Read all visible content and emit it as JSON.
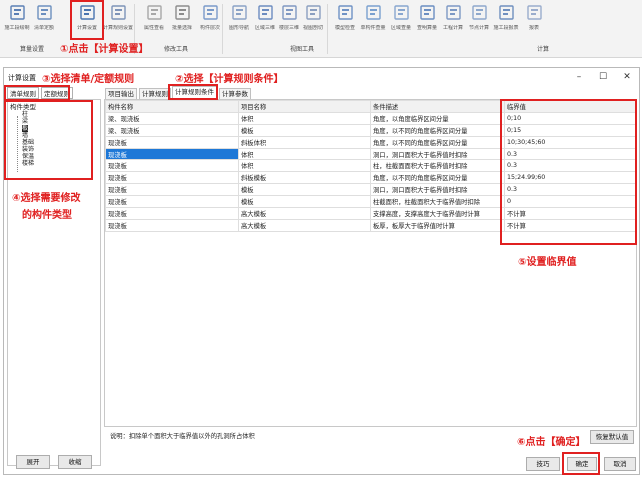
{
  "ribbon": {
    "buttons": [
      {
        "label": "施工段绘制",
        "icon": "floor-plan-icon"
      },
      {
        "label": "清单定额",
        "icon": "list-icon"
      },
      {
        "label": "计算设置",
        "icon": "calc-settings-icon"
      },
      {
        "label": "计算规则设置",
        "icon": "rules-icon"
      },
      {
        "label": "属性查看",
        "icon": "bulb-icon"
      },
      {
        "label": "批量选择",
        "icon": "filter-icon"
      },
      {
        "label": "构件层次",
        "icon": "layers-icon"
      },
      {
        "label": "图形导航",
        "icon": "tree-icon"
      },
      {
        "label": "区域三维",
        "icon": "cube-icon"
      },
      {
        "label": "楼层三维",
        "icon": "building-icon"
      },
      {
        "label": "视图剖切",
        "icon": "section-icon"
      },
      {
        "label": "模型检查",
        "icon": "check-icon"
      },
      {
        "label": "单构件查量",
        "icon": "component-qty-icon"
      },
      {
        "label": "区域查量",
        "icon": "area-qty-icon"
      },
      {
        "label": "查明算量",
        "icon": "detail-qty-icon"
      },
      {
        "label": "工程计算",
        "icon": "sigma-icon"
      },
      {
        "label": "节点计算",
        "icon": "node-calc-icon"
      },
      {
        "label": "施工段报表",
        "icon": "report-icon"
      },
      {
        "label": "报表",
        "icon": "table-icon"
      }
    ],
    "groups": [
      "算量设置",
      "修改工具",
      "视图工具",
      "计算"
    ]
  },
  "annotations": {
    "a1": "①点击【计算设置】",
    "a2": "②选择【计算规则条件】",
    "a3": "③选择清单/定额规则",
    "a4_line1": "④选择需要修改",
    "a4_line2": "的构件类型",
    "a5": "⑤设置临界值",
    "a6": "⑥点击【确定】"
  },
  "dialog": {
    "title": "计算设置",
    "left_tabs": [
      "清单规则",
      "定额规则"
    ],
    "tree_header": "构件类型",
    "tree_items": [
      "柱",
      "梁",
      "板",
      "墙",
      "基础",
      "装饰",
      "保温",
      "楼梯"
    ],
    "tree_selected": "板",
    "expand_label": "展开",
    "collapse_label": "收缩",
    "right_tabs": [
      "项目输出",
      "计算规则",
      "计算规则条件",
      "计算参数"
    ],
    "active_tab": "计算规则条件",
    "columns": [
      "构件名称",
      "项目名称",
      "条件描述",
      "临界值"
    ],
    "rows": [
      [
        "梁、现浇板",
        "体积",
        "角度，以角度临界区间分量",
        "0;10"
      ],
      [
        "梁、现浇板",
        "模板",
        "角度，以不同的角度临界区间分量",
        "0;15"
      ],
      [
        "现浇板",
        "斜板体积",
        "角度，以不同的角度临界区间分量",
        "10;30;45;60"
      ],
      [
        "现浇板",
        "体积",
        "洞口，洞口面积大于临界值时扣除",
        "0.3"
      ],
      [
        "现浇板",
        "体积",
        "柱，柱截面面积大于临界值时扣除",
        "0.3"
      ],
      [
        "现浇板",
        "斜板模板",
        "角度，以不同的角度临界区间分量",
        "15;24.99;60"
      ],
      [
        "现浇板",
        "模板",
        "洞口，洞口面积大于临界值时扣除",
        "0.3"
      ],
      [
        "现浇板",
        "模板",
        "柱截面积，柱截面积大于临界值时扣除",
        "0"
      ],
      [
        "现浇板",
        "高大模板",
        "支撑高度，支撑高度大于临界值时计算",
        "不计算"
      ],
      [
        "现浇板",
        "高大模板",
        "板厚，板厚大于临界值时计算",
        "不计算"
      ]
    ],
    "selected_cell": {
      "row": 3,
      "col": 0
    },
    "description": "说明：扣除单个面积大于临界值以外的孔洞所占体积",
    "restore_default_label": "恢复默认值",
    "tips_label": "技巧",
    "ok_label": "确定",
    "cancel_label": "取消",
    "minimize": "–",
    "maximize": "☐",
    "close": "✕"
  }
}
